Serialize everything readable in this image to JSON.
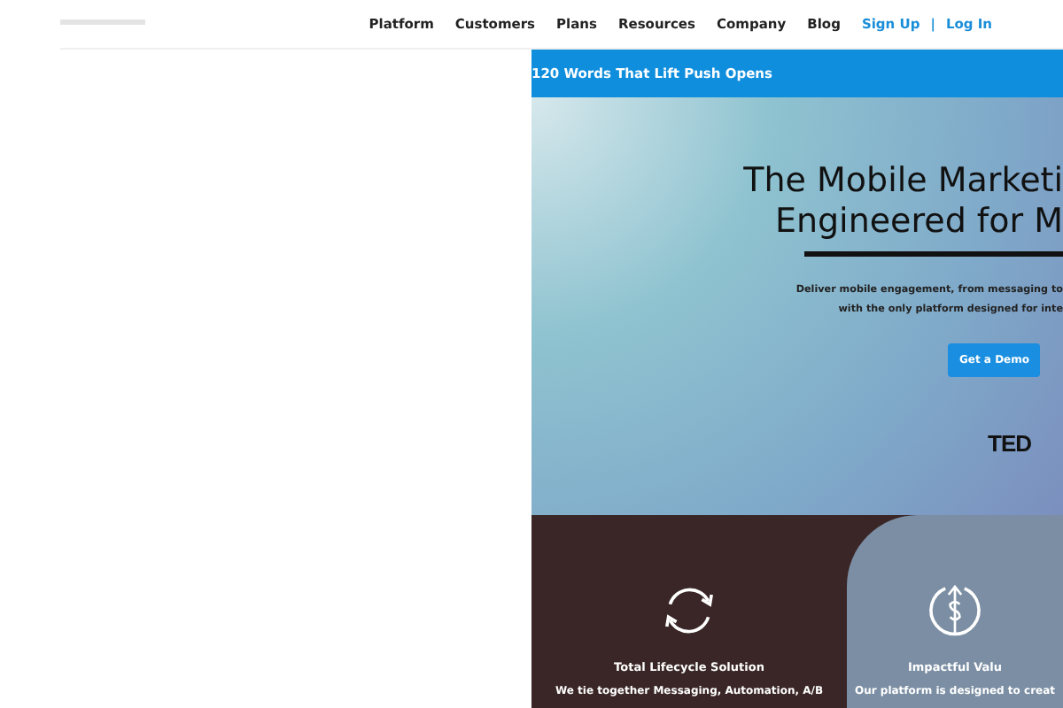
{
  "nav": {
    "items": [
      {
        "label": "Platform"
      },
      {
        "label": "Customers"
      },
      {
        "label": "Plans"
      },
      {
        "label": "Resources"
      },
      {
        "label": "Company"
      },
      {
        "label": "Blog"
      }
    ],
    "sign_up": "Sign Up",
    "separator": "|",
    "log_in": "Log In"
  },
  "banner": {
    "text": "120 Words That Lift Push Opens"
  },
  "hero": {
    "title_lines": [
      "The Mobile Marketi",
      "Engineered for M"
    ],
    "subtitle_lines": [
      "Deliver mobile engagement, from messaging to",
      "with the only platform designed for inte"
    ],
    "button": "Get a Demo",
    "logo_text": "TED"
  },
  "features": [
    {
      "kind": "cycle",
      "title": "Total Lifecycle Solution",
      "text": "We tie together Messaging, Automation, A/B"
    },
    {
      "kind": "value",
      "title": "Impactful Valu",
      "text": "Our platform is designed to creat"
    }
  ]
}
